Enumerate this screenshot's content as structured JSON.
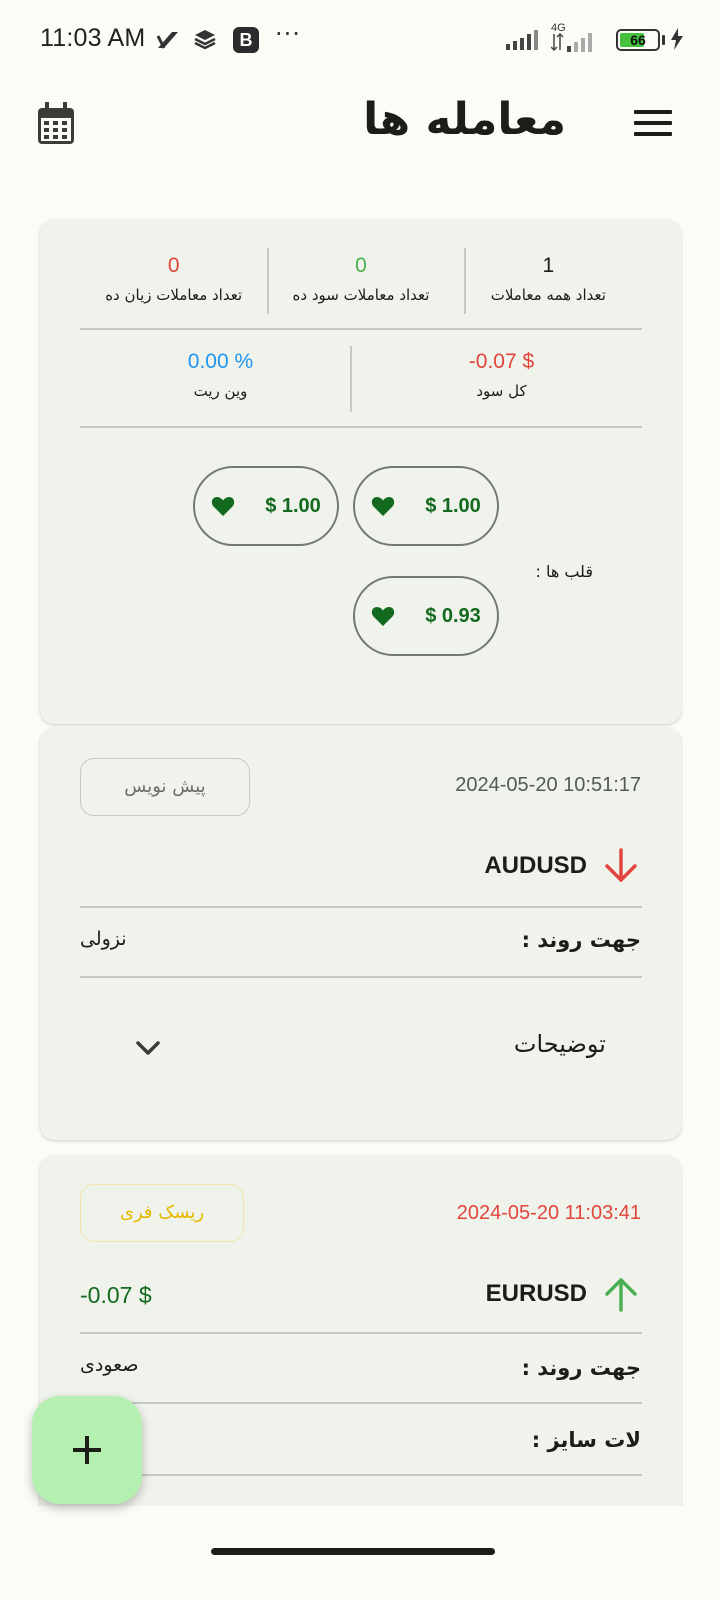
{
  "status_bar": {
    "time": "11:03 AM",
    "b_badge": "B",
    "dots": "···",
    "network": "4G",
    "battery": "66"
  },
  "header": {
    "title": "معامله ها",
    "menu_icon": "menu-icon",
    "calendar_icon": "calendar-icon"
  },
  "stats": {
    "total_trades_value": "1",
    "total_trades_label": "تعداد همه معاملات",
    "win_trades_value": "0",
    "win_trades_label": "تعداد معاملات سود ده",
    "loss_trades_value": "0",
    "loss_trades_label": "تعداد معاملات زیان ده",
    "total_profit_value": "-0.07 $",
    "total_profit_label": "کل سود",
    "win_rate_value": "0.00 %",
    "win_rate_label": "وین ریت",
    "hearts_label": "قلب ها :",
    "hearts": [
      "$ 1.00",
      "$ 1.00",
      "$ 0.93"
    ]
  },
  "trades": [
    {
      "datetime": "2024-05-20 10:51:17",
      "tag": "پیش نویس",
      "symbol": "AUDUSD",
      "direction": "down",
      "trend_label": "جهت روند :",
      "trend_value": "نزولی",
      "description_label": "توضیحات"
    },
    {
      "datetime": "2024-05-20 11:03:41",
      "tag": "ریسک فری",
      "symbol": "EURUSD",
      "direction": "up",
      "pnl": "-0.07 $",
      "trend_label": "جهت روند :",
      "trend_value": "صعودی",
      "lot_label": "لات سایز :"
    }
  ],
  "colors": {
    "loss": "#e2453c",
    "win": "#4caf50",
    "winrate": "#2196f3",
    "heart": "#136a1f",
    "tag_yellow": "#e6b800",
    "fab": "#b6f0b1"
  }
}
